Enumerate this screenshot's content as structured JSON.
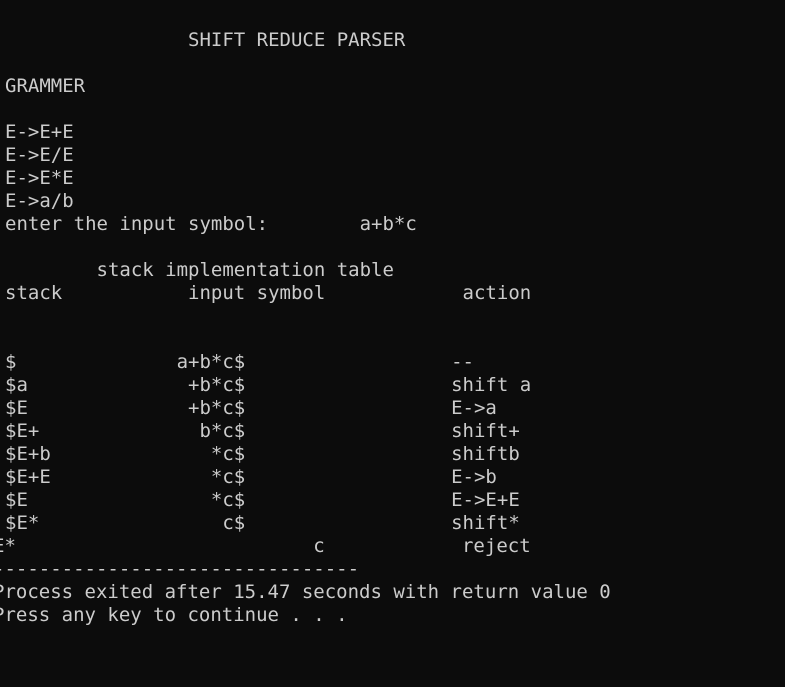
{
  "console": {
    "lines": [
      "                SHIFT REDUCE PARSER",
      "",
      "GRAMMER",
      "",
      "E->E+E",
      "E->E/E",
      "E->E*E",
      "E->a/b",
      "enter the input symbol:        a+b*c",
      "",
      "        stack implementation table",
      "stack           input symbol            action",
      "",
      "",
      "$              a+b*c$                  --",
      "$a              +b*c$                  shift a",
      "$E              +b*c$                  E->a",
      "$E+              b*c$                  shift+",
      "$E+b              *c$                  shiftb",
      "$E+E              *c$                  E->b",
      "$E                *c$                  E->E+E",
      "$E*                c$                  shift*",
      "E*                          c            reject",
      "--------------------------------",
      "Process exited after 15.47 seconds with return value 0",
      "Press any key to continue . . ."
    ]
  }
}
